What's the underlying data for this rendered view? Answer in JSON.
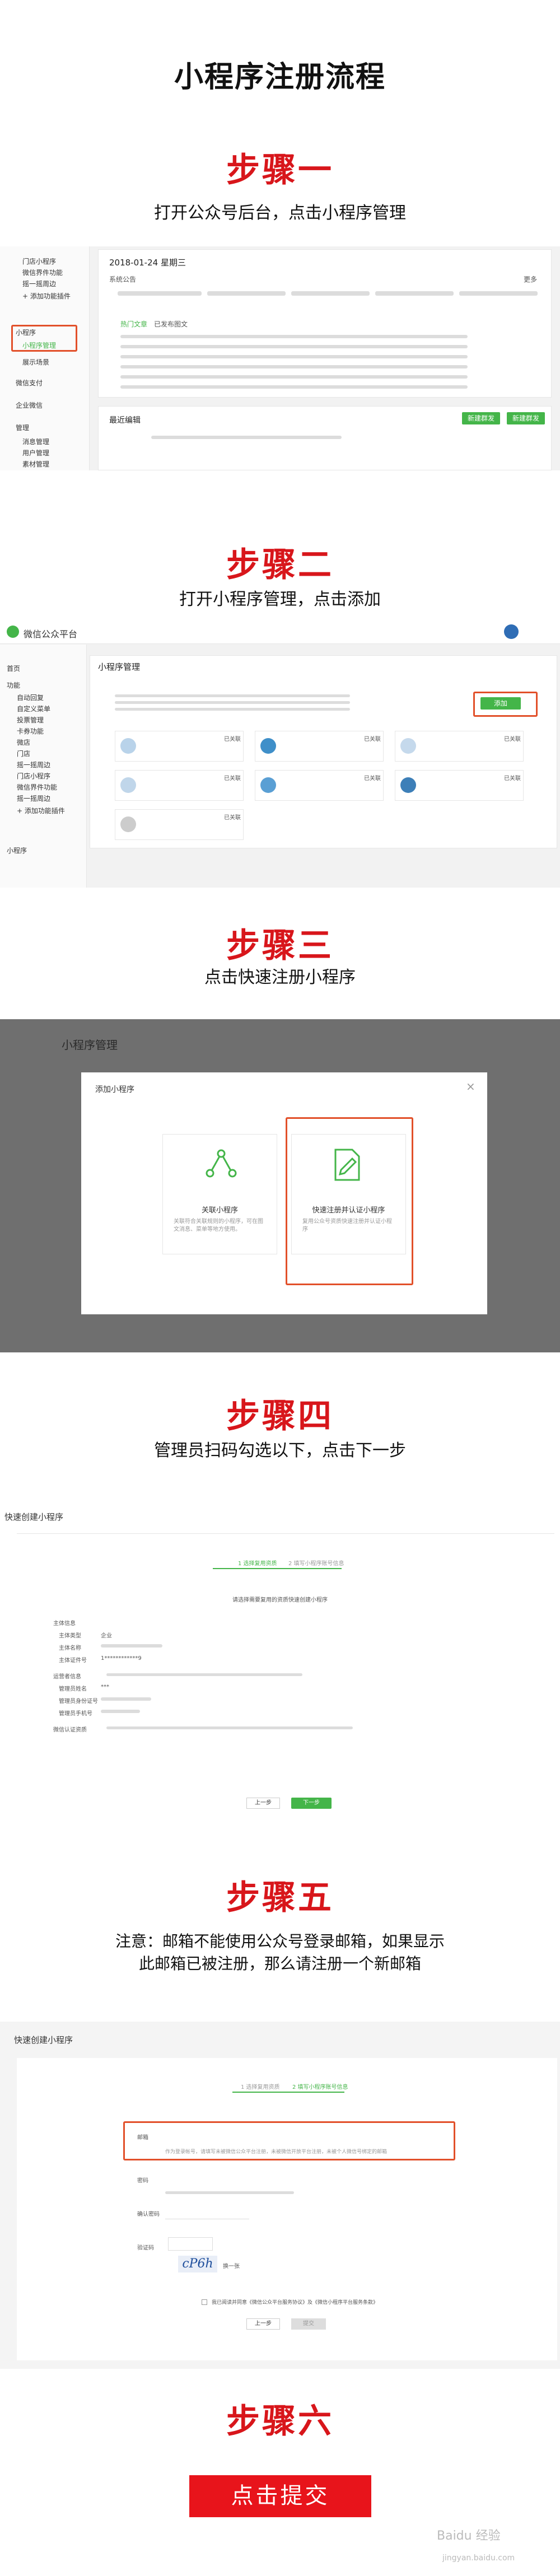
{
  "title": "小程序注册流程",
  "steps": [
    {
      "title": "步骤一",
      "desc": "打开公众号后台，点击小程序管理"
    },
    {
      "title": "步骤二",
      "desc": "打开小程序管理，点击添加"
    },
    {
      "title": "步骤三",
      "desc": "点击快速注册小程序"
    },
    {
      "title": "步骤四",
      "desc": "管理员扫码勾选以下，点击下一步"
    },
    {
      "title": "步骤五",
      "desc_line1": "注意：邮箱不能使用公众号登录邮箱，如果显示",
      "desc_line2": "此邮箱已被注册，那么请注册一个新邮箱"
    },
    {
      "title": "步骤六"
    }
  ],
  "shot1": {
    "date": "2018-01-24 星期三",
    "announce_label": "系统公告",
    "more": "更多",
    "tabs": [
      "热门文章",
      "已发布图文"
    ],
    "sidebar": [
      "门店小程序",
      "微信界件功能",
      "摇一摇周边",
      "+ 添加功能插件",
      "小程序",
      "小程序管理",
      "展示场景",
      "微信支付",
      "企业微信",
      "管理",
      "消息管理",
      "用户管理",
      "素材管理"
    ],
    "recent_label": "最近编辑",
    "buttons": [
      "新建群发",
      "新建群发"
    ]
  },
  "shot2": {
    "brand": "微信公众平台",
    "page_title": "小程序管理",
    "add_button": "添加",
    "sidebar": [
      "首页",
      "功能",
      "自动回复",
      "自定义菜单",
      "投票管理",
      "卡券功能",
      "微店",
      "门店",
      "摇一摇周边",
      "门店小程序",
      "微信界件功能",
      "摇一摇周边",
      "+ 添加功能插件",
      "小程序"
    ],
    "card_status": "已关联"
  },
  "shot3": {
    "page_title": "小程序管理",
    "dialog_title": "添加小程序",
    "option_left": "关联小程序",
    "option_left_desc": "关联符合关联规则的小程序，可在图文消息、菜单等地方使用。",
    "option_right": "快速注册并认证小程序",
    "option_right_desc": "复用公众号资质快速注册并认证小程序"
  },
  "shot4": {
    "header": "快速创建小程序",
    "progress": [
      "1 选择复用资质",
      "2 填写小程序账号信息"
    ],
    "scan_tip": "请选择需要复用的资质快速创建小程序",
    "fields": [
      "主体信息",
      "主体类型",
      "主体名称",
      "主体证件号",
      "运营者信息",
      "管理员姓名",
      "管理员身份证号",
      "管理员手机号",
      "微信认证资质"
    ],
    "field_values": [
      "企业",
      "1************9",
      "***"
    ],
    "buttons": [
      "上一步",
      "下一步"
    ]
  },
  "shot5": {
    "header": "快速创建小程序",
    "progress": [
      "1 选择复用资质",
      "2 填写小程序账号信息"
    ],
    "fields": [
      "邮箱",
      "密码",
      "确认密码",
      "验证码"
    ],
    "email_placeholder": "作为登录帐号，请填写未被微信公众平台注册，未被微信开放平台注册，未被个人微信号绑定的邮箱",
    "captcha": "cP6h",
    "captcha_link": "换一张",
    "agree": "我已阅读并同意《微信公众平台服务协议》及《微信小程序平台服务条款》",
    "buttons": [
      "上一步",
      "提交"
    ]
  },
  "submit_label": "点击提交",
  "watermark": "Baidu 经验",
  "watermark_url": "jingyan.baidu.com"
}
